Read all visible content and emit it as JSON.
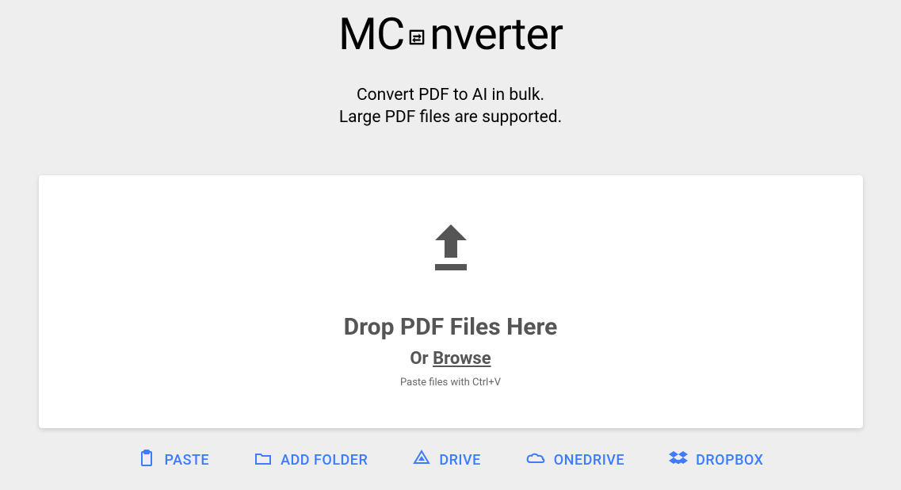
{
  "logo": {
    "pre": "MC",
    "post": "nverter"
  },
  "tagline": {
    "line1": "Convert PDF to AI in bulk.",
    "line2": "Large PDF files are supported."
  },
  "dropzone": {
    "title": "Drop PDF Files Here",
    "or": "Or ",
    "browse": "Browse",
    "hint": "Paste files with Ctrl+V"
  },
  "actions": {
    "paste": "PASTE",
    "addFolder": "ADD FOLDER",
    "drive": "DRIVE",
    "onedrive": "ONEDRIVE",
    "dropbox": "DROPBOX"
  }
}
